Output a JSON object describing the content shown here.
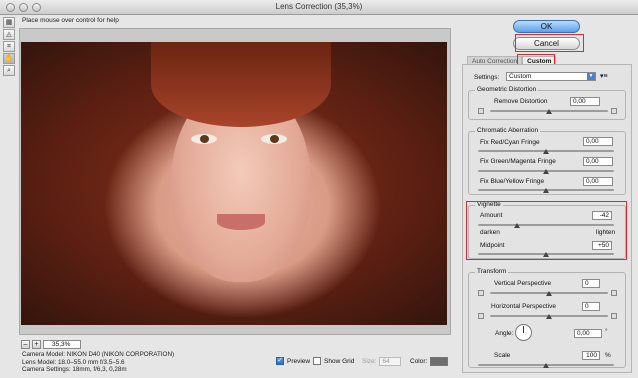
{
  "window": {
    "title": "Lens Correction (35,3%)"
  },
  "hint": "Place mouse over control for help",
  "tools": [
    "remove-distortion-tool",
    "straighten-tool",
    "move-grid-tool",
    "hand-tool",
    "zoom-tool"
  ],
  "zoom": {
    "minus": "–",
    "plus": "+",
    "value": "35,3%"
  },
  "camera": {
    "model": "Camera Model: NIKON D40 (NIKON CORPORATION)",
    "lens": "Lens Model: 18.0–55.0 mm f/3.5–5.6",
    "settings": "Camera Settings: 18mm, f/6,3, 0,28m"
  },
  "bottom": {
    "preview": "Preview",
    "show_grid": "Show Grid",
    "size_label": "Size:",
    "size_value": "64",
    "color_label": "Color:"
  },
  "buttons": {
    "ok": "OK",
    "cancel": "Cancel"
  },
  "tabs": [
    "Auto Correction",
    "Custom"
  ],
  "settings": {
    "label": "Settings:",
    "value": "Custom"
  },
  "geometric": {
    "title": "Geometric Distortion",
    "remove_label": "Remove Distortion",
    "remove_value": "0,00"
  },
  "chromatic": {
    "title": "Chromatic Aberration",
    "items": [
      {
        "label": "Fix Red/Cyan Fringe",
        "value": "0,00"
      },
      {
        "label": "Fix Green/Magenta Fringe",
        "value": "0,00"
      },
      {
        "label": "Fix Blue/Yellow Fringe",
        "value": "0,00"
      }
    ]
  },
  "vignette": {
    "title": "Vignette",
    "amount_label": "Amount",
    "amount_value": "-42",
    "darken": "darken",
    "lighten": "lighten",
    "midpoint_label": "Midpoint",
    "midpoint_value": "+50"
  },
  "transform": {
    "title": "Transform",
    "vertical_label": "Vertical Perspective",
    "vertical_value": "0",
    "horizontal_label": "Horizontal Perspective",
    "horizontal_value": "0",
    "angle_label": "Angle:",
    "angle_value": "0,00",
    "angle_unit": "°",
    "scale_label": "Scale",
    "scale_value": "100",
    "scale_unit": "%"
  }
}
